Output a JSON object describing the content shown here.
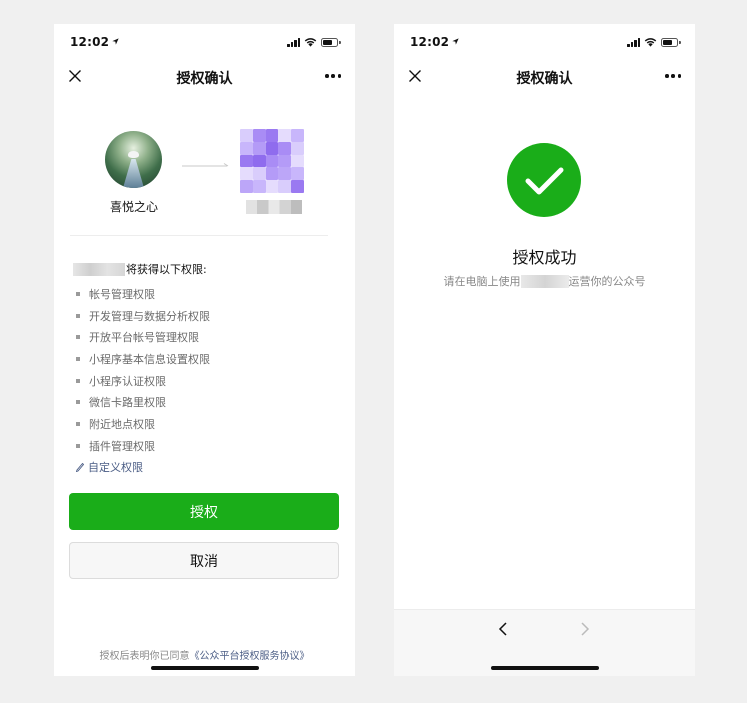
{
  "left": {
    "status_time": "12:02",
    "title": "授权确认",
    "user_name": "喜悦之心",
    "permissions_heading": "将获得以下权限:",
    "permissions": [
      "帐号管理权限",
      "开发管理与数据分析权限",
      "开放平台帐号管理权限",
      "小程序基本信息设置权限",
      "小程序认证权限",
      "微信卡路里权限",
      "附近地点权限",
      "插件管理权限"
    ],
    "custom_link": "自定义权限",
    "authorize_button": "授权",
    "cancel_button": "取消",
    "agreement_prefix": "授权后表明你已同意",
    "agreement_link": "《公众平台授权服务协议》"
  },
  "right": {
    "status_time": "12:02",
    "title": "授权确认",
    "success_title": "授权成功",
    "success_desc_prefix": "请在电脑上使用",
    "success_desc_suffix": "运营你的公众号"
  },
  "colors": {
    "accent_green": "#1aad19",
    "link_blue": "#4b5d85",
    "mosaic_purple": "#a98cf5"
  },
  "icons": [
    "location-arrow-icon",
    "signal-icon",
    "wifi-icon",
    "battery-icon",
    "close-icon",
    "more-icon",
    "arrow-right-icon",
    "pencil-icon",
    "checkmark-icon",
    "back-icon",
    "forward-icon"
  ]
}
